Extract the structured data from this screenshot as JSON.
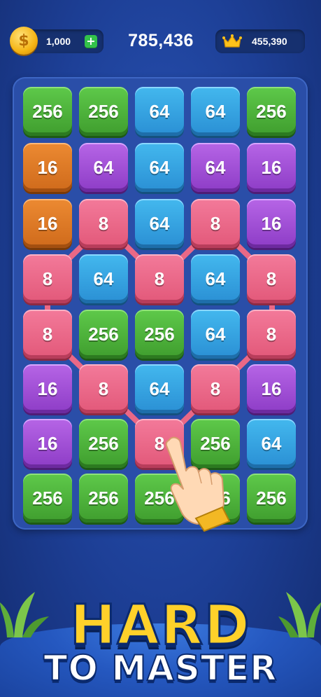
{
  "hud": {
    "coins": "1,000",
    "add_label": "+",
    "coin_symbol": "$",
    "score": "785,436",
    "best": "455,390"
  },
  "board": {
    "rows": [
      [
        "256",
        "256",
        "64",
        "64",
        "256"
      ],
      [
        "16",
        "64",
        "64",
        "64",
        "16"
      ],
      [
        "16",
        "8",
        "64",
        "8",
        "16"
      ],
      [
        "8",
        "64",
        "8",
        "64",
        "8"
      ],
      [
        "8",
        "256",
        "256",
        "64",
        "8"
      ],
      [
        "16",
        "8",
        "64",
        "8",
        "16"
      ],
      [
        "16",
        "256",
        "8",
        "256",
        "64"
      ],
      [
        "256",
        "256",
        "256",
        "256",
        "256"
      ]
    ],
    "colors": {
      "256": "#4caf3a",
      "64": "#35a3e2",
      "16": "#e07a26",
      "8": "#ea6886",
      "16-purple": "#a550d8",
      "64-purple": "#a550d8"
    }
  },
  "banner": {
    "line1": "HARD",
    "line2": "TO MASTER"
  }
}
